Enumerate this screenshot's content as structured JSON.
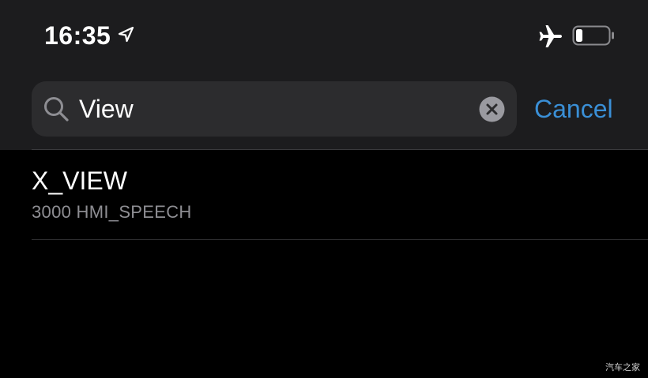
{
  "status_bar": {
    "time": "16:35",
    "icons": [
      "location-arrow-icon",
      "airplane-mode-icon",
      "battery-low-icon"
    ]
  },
  "search": {
    "value": "View",
    "icon": "search-icon",
    "clear_icon": "clear-circle-icon",
    "cancel_label": "Cancel"
  },
  "results": [
    {
      "title": "X_VIEW",
      "subtitle": "3000 HMI_SPEECH"
    }
  ],
  "watermark": "汽车之家",
  "colors": {
    "background": "#000000",
    "header_background": "#1c1c1e",
    "search_field": "#2c2c2e",
    "accent": "#3a8fd6",
    "secondary_text": "#8e8e93"
  }
}
